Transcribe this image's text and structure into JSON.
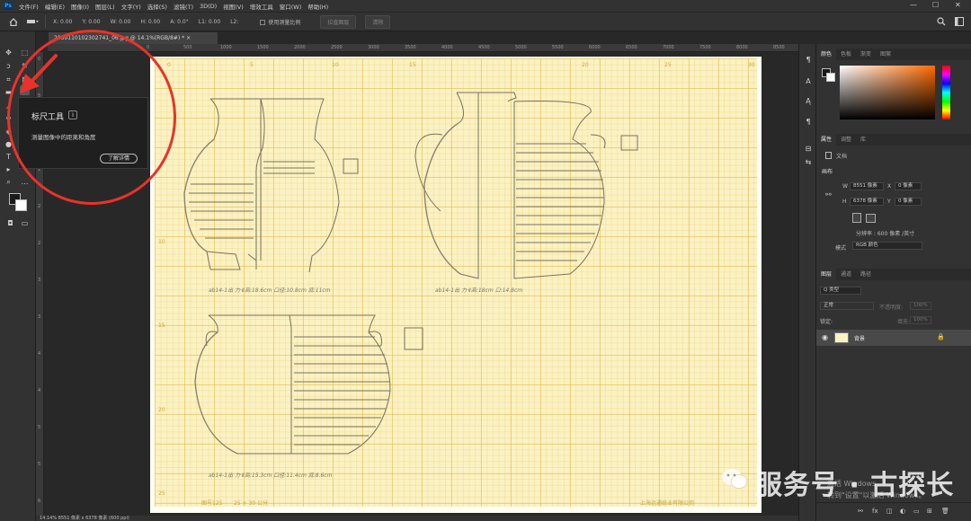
{
  "menubar": {
    "logo": "Ps",
    "items": [
      "文件(F)",
      "编辑(E)",
      "图像(I)",
      "图层(L)",
      "文字(Y)",
      "选择(S)",
      "滤镜(T)",
      "3D(D)",
      "视图(V)",
      "增效工具",
      "窗口(W)",
      "帮助(H)"
    ],
    "minimize": "—",
    "maximize": "☐",
    "close": "✕"
  },
  "options": {
    "x": "X: 0.00",
    "y": "Y: 0.00",
    "w": "W: 0.00",
    "h": "H: 0.00",
    "a": "A: 0.0°",
    "l1": "L1: 0.00",
    "l2": "L2:",
    "scale_checkbox": "使用测量比例",
    "straighten_btn": "拉直图层",
    "clear_btn": "清除"
  },
  "document": {
    "tab_title": "2050110102302741_06.jpg @ 14.1%(RGB/8#) *",
    "close": "×"
  },
  "ruler_h": [
    "0",
    "500",
    "1000",
    "1500",
    "2000",
    "2500",
    "3000",
    "3500",
    "4000",
    "4500",
    "5000",
    "5500",
    "6000",
    "6500",
    "7000",
    "7500",
    "8000",
    "8500"
  ],
  "ruler_v": [
    "0",
    "5",
    "1",
    "1",
    "2",
    "2",
    "3",
    "3",
    "4",
    "4",
    "5",
    "5",
    "6"
  ],
  "paper": {
    "top_numbers": [
      "0",
      "5",
      "10",
      "15",
      "20",
      "25",
      "30"
    ],
    "left_numbers": [
      "10",
      "15",
      "20",
      "25"
    ],
    "footer_left": "图号125",
    "footer_mid": "25 × 30 公分",
    "footer_right": "上海远通纸业有限公司"
  },
  "notes": {
    "vase1": "ab14-1出 力·Ⅱ高:18.6cm  口径:10.8cm  底:11cm",
    "vase2": "ab14-1出 力·Ⅱ高:18cm  口:14.8cm",
    "vase3": "ab14-1出 力·Ⅱ高:15.3cm  口径:11.4cm  底:8.6cm"
  },
  "tooltip": {
    "title": "标尺工具",
    "key": "I",
    "desc": "测量图像中的距离和角度",
    "learn": "了解详情"
  },
  "panels": {
    "color_tabs": [
      "颜色",
      "色板",
      "渐变",
      "图案"
    ],
    "props_tabs": [
      "属性",
      "调整",
      "库"
    ],
    "doc_label": "文档",
    "canvas_label": "画布",
    "w_label": "W",
    "w_val": "8551 像素",
    "x_label": "X",
    "x_val": "0 像素",
    "h_label": "H",
    "h_val": "6378 像素",
    "y_label": "Y",
    "y_val": "0 像素",
    "resolution": "分辨率 : 600 像素 /英寸",
    "mode_label": "模式",
    "mode_val": "RGB 颜色",
    "layers_tabs": [
      "图层",
      "通道",
      "路径"
    ],
    "kind": "Q 类型",
    "blend": "正常",
    "opacity": "不透明度:",
    "opacity_val": "100%",
    "lock": "锁定:",
    "fill": "填充:",
    "fill_val": "100%",
    "layer_name": "背景"
  },
  "watermark": "服务号 · 古探长",
  "windows": {
    "line1": "激活 Windows",
    "line2": "转到\"设置\"以激活 Windows。"
  },
  "status": "14.14%   8551 像素 x 6378 像素 (600 ppi)"
}
